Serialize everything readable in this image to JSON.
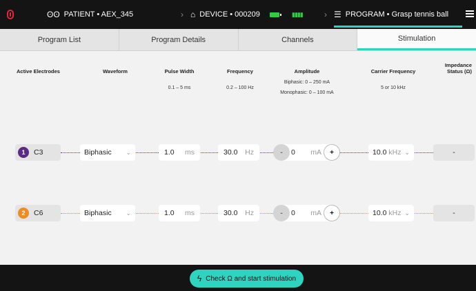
{
  "topbar": {
    "patient": "PATIENT • AEX_345",
    "device": "DEVICE • 000209",
    "program": "PROGRAM • Grasp tennis ball"
  },
  "tabs": [
    {
      "label": "Program List",
      "active": false
    },
    {
      "label": "Program Details",
      "active": false
    },
    {
      "label": "Channels",
      "active": false
    },
    {
      "label": "Stimulation",
      "active": true
    }
  ],
  "columns": {
    "active_electrodes": "Active Electrodes",
    "waveform": "Waveform",
    "pulse_width": "Pulse Width",
    "frequency": "Frequency",
    "amplitude": "Amplitude",
    "carrier_frequency": "Carrier Frequency",
    "impedance": "Impedance Status (Ω)"
  },
  "ranges": {
    "pulse_width": "0.1 – 5 ms",
    "frequency": "0.2 – 100 Hz",
    "amplitude_biphasic": "Biphasic: 0 – 250 mA",
    "amplitude_monophasic": "Monophasic: 0 – 100 mA",
    "carrier_frequency": "5 or 10 kHz"
  },
  "rows": [
    {
      "index": "1",
      "electrode": "C3",
      "color": "#5b2a86",
      "waveform": "Biphasic",
      "pulse_width": "1.0",
      "pulse_unit": "ms",
      "frequency": "30.0",
      "frequency_unit": "Hz",
      "amplitude": "0",
      "amplitude_unit": "mA",
      "carrier": "10.0",
      "carrier_unit": "kHz",
      "impedance": "-"
    },
    {
      "index": "2",
      "electrode": "C6",
      "color": "#f08a24",
      "waveform": "Biphasic",
      "pulse_width": "1.0",
      "pulse_unit": "ms",
      "frequency": "30.0",
      "frequency_unit": "Hz",
      "amplitude": "0",
      "amplitude_unit": "mA",
      "carrier": "10.0",
      "carrier_unit": "kHz",
      "impedance": "-"
    }
  ],
  "bottom": {
    "start_label": "Check Ω and start stimulation"
  },
  "colors": {
    "accent": "#2fd4c0",
    "row1": "#5b2a86",
    "row2": "#f08a24"
  }
}
